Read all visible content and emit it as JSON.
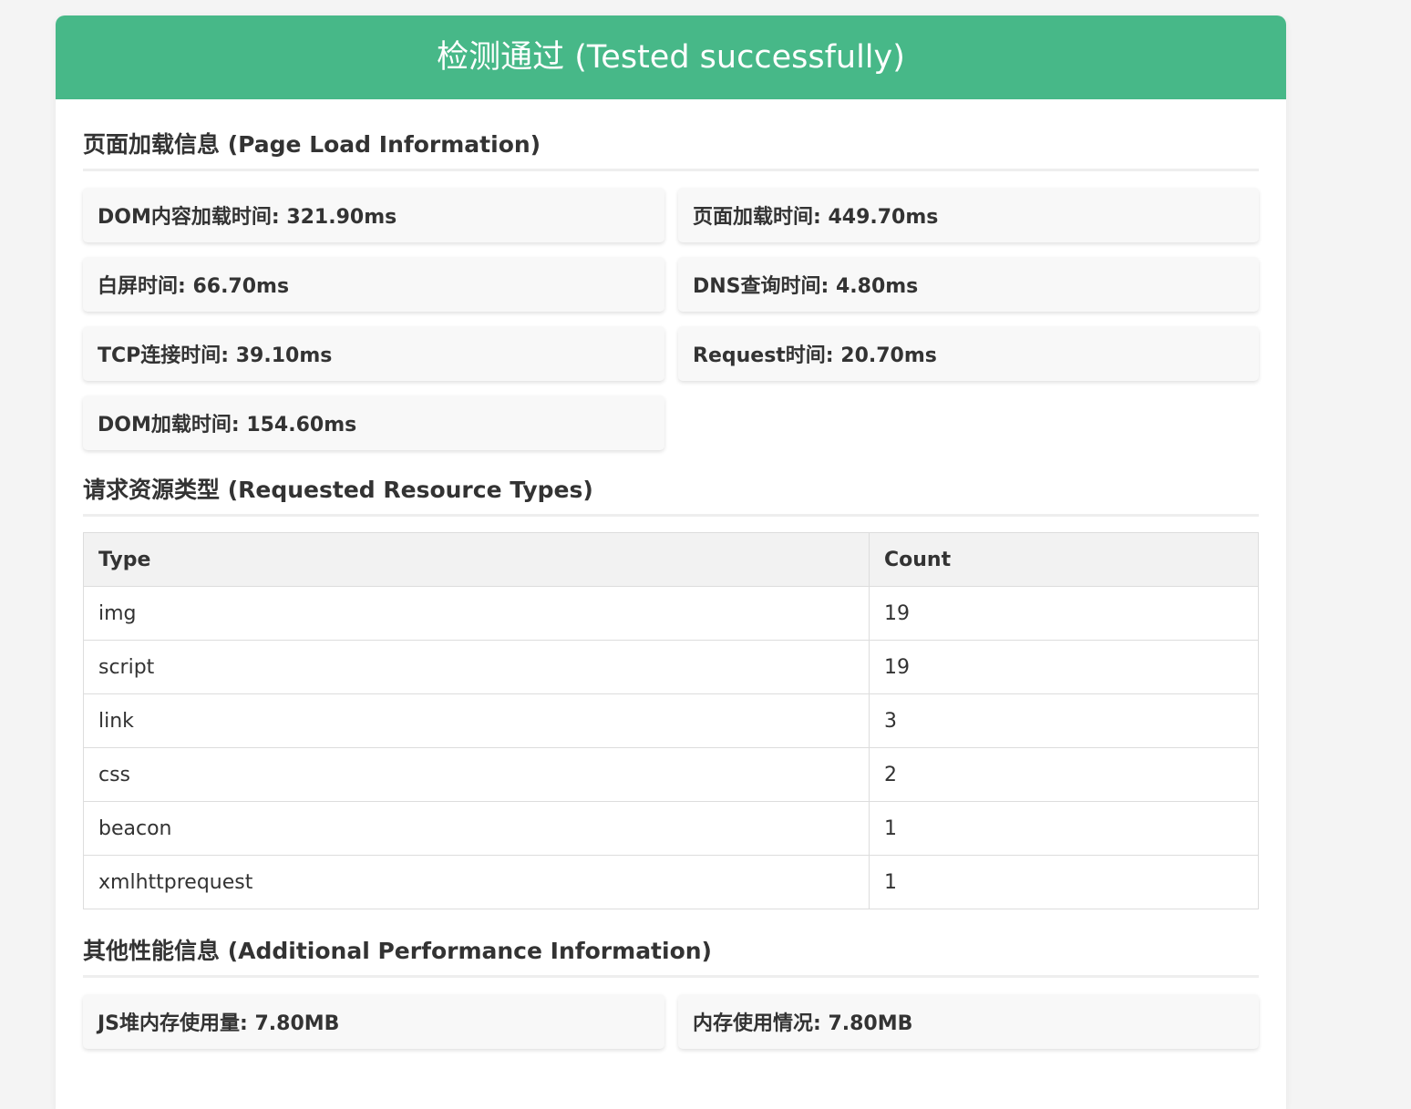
{
  "header": {
    "title": "检测通过 (Tested successfully)",
    "color": "#47b888"
  },
  "page_load": {
    "title": "页面加载信息 (Page Load Information)",
    "metrics": [
      "DOM内容加载时间: 321.90ms",
      "页面加载时间: 449.70ms",
      "白屏时间: 66.70ms",
      "DNS查询时间: 4.80ms",
      "TCP连接时间: 39.10ms",
      "Request时间: 20.70ms",
      "DOM加载时间: 154.60ms"
    ]
  },
  "resources": {
    "title": "请求资源类型 (Requested Resource Types)",
    "columns": [
      "Type",
      "Count"
    ],
    "rows": [
      [
        "img",
        "19"
      ],
      [
        "script",
        "19"
      ],
      [
        "link",
        "3"
      ],
      [
        "css",
        "2"
      ],
      [
        "beacon",
        "1"
      ],
      [
        "xmlhttprequest",
        "1"
      ]
    ]
  },
  "additional": {
    "title": "其他性能信息 (Additional Performance Information)",
    "metrics": [
      "JS堆内存使用量: 7.80MB",
      "内存使用情况: 7.80MB"
    ]
  }
}
